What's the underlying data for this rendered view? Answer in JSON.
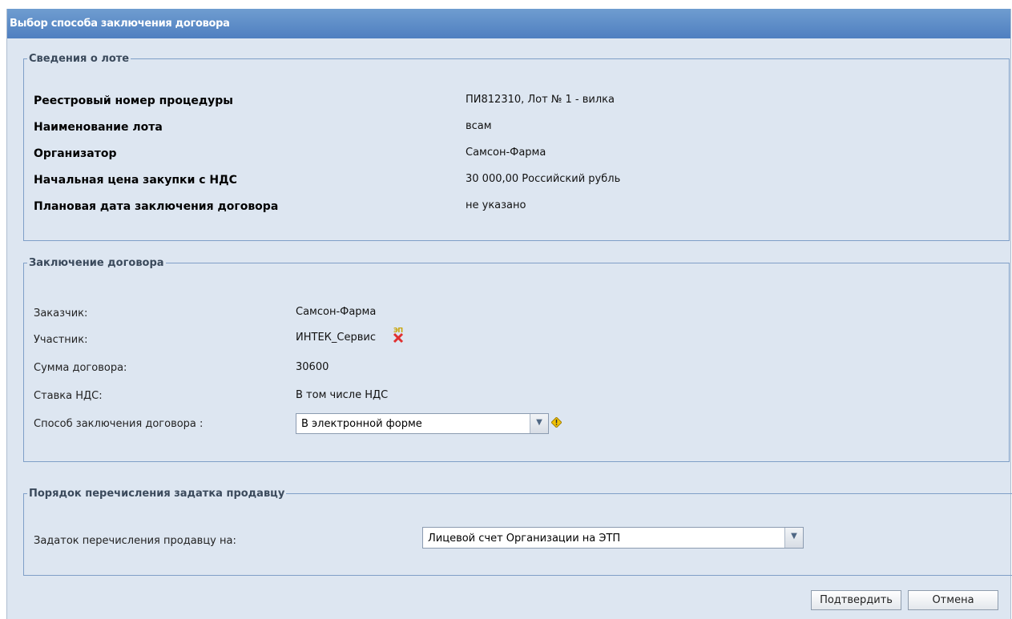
{
  "window": {
    "title": "Выбор способа заключения договора"
  },
  "lot_info": {
    "legend": "Сведения о лоте",
    "rows": [
      {
        "label": "Реестровый номер процедуры",
        "value": "ПИ812310, Лот № 1 - вилка"
      },
      {
        "label": "Наименование лота",
        "value": "всам"
      },
      {
        "label": "Организатор",
        "value": "Самсон-Фарма"
      },
      {
        "label": "Начальная цена закупки с НДС",
        "value": "30 000,00 Российский рубль"
      },
      {
        "label": "Плановая дата заключения договора",
        "value": "не указано"
      }
    ]
  },
  "contract": {
    "legend": "Заключение договора",
    "customer_label": "Заказчик:",
    "customer_value": "Самсон-Фарма",
    "participant_label": "Участник:",
    "participant_value": "ИНТЕК_Сервис",
    "participant_icon_text": "ЭП",
    "sum_label": "Сумма договора:",
    "sum_value": "30600",
    "vat_label": "Ставка НДС:",
    "vat_value": "В том числе НДС",
    "method_label": "Способ заключения договора :",
    "method_value": "В электронной форме"
  },
  "deposit": {
    "legend": "Порядок перечисления задатка продавцу",
    "label": "Задаток перечисления продавцу на:",
    "value": "Лицевой счет Организации на ЭТП"
  },
  "buttons": {
    "confirm": "Подтвердить",
    "cancel": "Отмена"
  },
  "icons": {
    "dropdown": "chevron-down-icon",
    "warning": "warning-diamond-icon",
    "signature": "signature-invalid-icon"
  }
}
